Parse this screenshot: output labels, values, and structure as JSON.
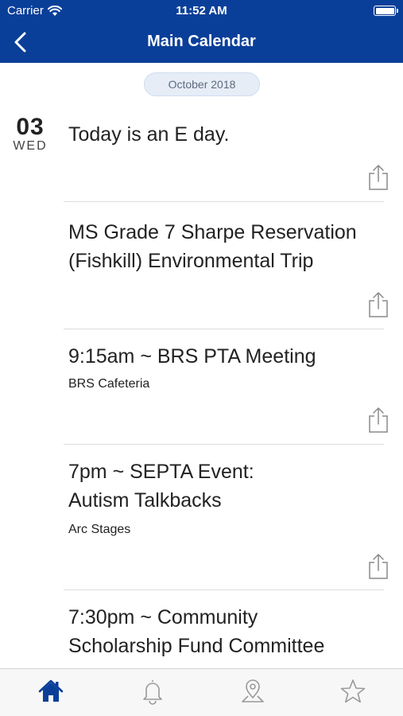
{
  "status_bar": {
    "carrier": "Carrier",
    "time": "11:52 AM",
    "wifi_icon": "wifi-icon",
    "battery_icon": "battery-icon"
  },
  "nav": {
    "title": "Main Calendar",
    "back_icon": "chevron-left-icon"
  },
  "month_label": "October 2018",
  "date": {
    "day": "03",
    "weekday": "WED"
  },
  "events": [
    {
      "title": "Today is an E day.",
      "location": ""
    },
    {
      "title": "MS Grade 7 Sharpe Reservation (Fishkill) Environmental Trip",
      "location": ""
    },
    {
      "title": "9:15am ~ BRS PTA Meeting",
      "location": "BRS Cafeteria"
    },
    {
      "title": "7pm ~ SEPTA Event: Autism Talkbacks",
      "location": "Arc Stages"
    },
    {
      "title": "7:30pm ~ Community Scholarship Fund Committee",
      "location": ""
    }
  ],
  "tabs": [
    {
      "icon": "home-icon",
      "active": true
    },
    {
      "icon": "bell-icon",
      "active": false
    },
    {
      "icon": "map-pin-icon",
      "active": false
    },
    {
      "icon": "star-icon",
      "active": false
    }
  ],
  "colors": {
    "brand": "#0a3f99",
    "pill_bg": "#e6edf7",
    "tab_active": "#0a3f99",
    "tab_inactive": "#9a9a9a"
  }
}
